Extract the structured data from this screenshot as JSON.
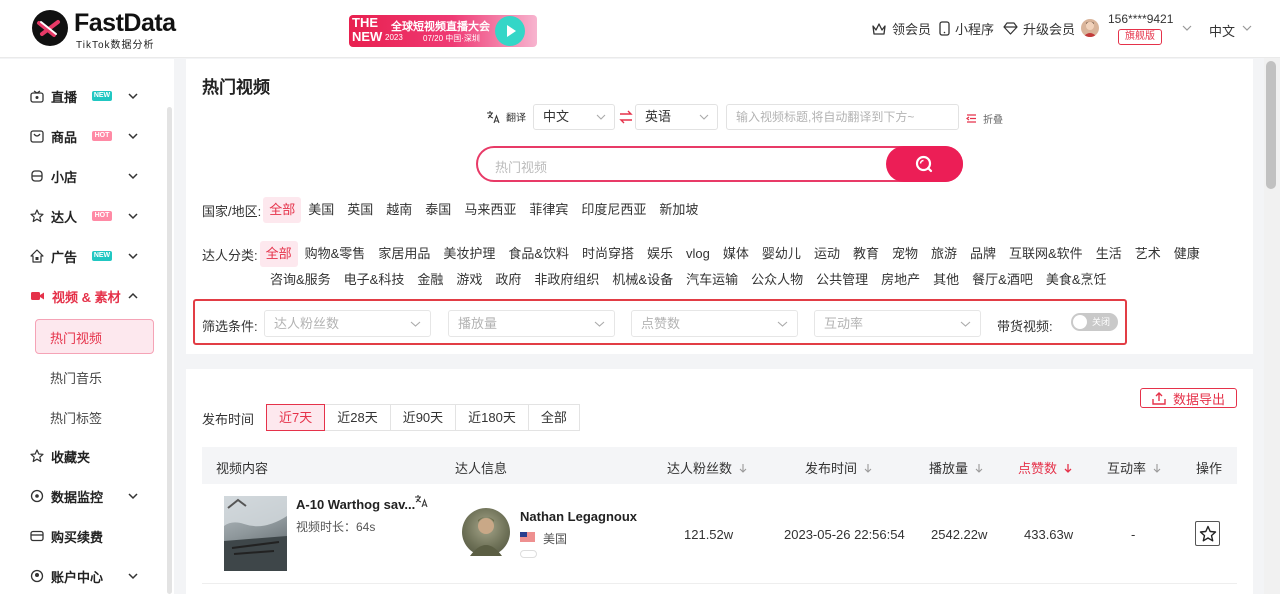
{
  "header": {
    "logo_name": "FastData",
    "logo_sub": "TikTok数据分析",
    "banner": {
      "the": "THE",
      "new": "NEW",
      "title": "全球短视频直播大会",
      "year": "2023",
      "date": "07/20 中国·深圳"
    },
    "nav": [
      {
        "label": "领会员",
        "icon": "crown-icon"
      },
      {
        "label": "小程序",
        "icon": "phone-icon"
      },
      {
        "label": "升级会员",
        "icon": "diamond-icon"
      }
    ],
    "user_phone": "156****9421",
    "user_plan": "旗舰版",
    "language": "中文"
  },
  "sidebar": {
    "items": [
      {
        "label": "直播",
        "icon": "live-icon",
        "badge": "NEW"
      },
      {
        "label": "商品",
        "icon": "bag-icon",
        "badge": "HOT"
      },
      {
        "label": "小店",
        "icon": "store-icon",
        "badge": ""
      },
      {
        "label": "达人",
        "icon": "star-icon",
        "badge": "HOT"
      },
      {
        "label": "广告",
        "icon": "ad-icon",
        "badge": "NEW"
      },
      {
        "label": "视频 & 素材",
        "icon": "video-icon",
        "badge": "",
        "active": true
      },
      {
        "label": "收藏夹",
        "icon": "star-outline-icon",
        "badge": ""
      },
      {
        "label": "数据监控",
        "icon": "monitor-icon",
        "badge": ""
      },
      {
        "label": "购买续费",
        "icon": "card-icon",
        "badge": ""
      },
      {
        "label": "账户中心",
        "icon": "user-icon",
        "badge": ""
      }
    ],
    "sub_items": [
      "热门视频",
      "热门音乐",
      "热门标签"
    ]
  },
  "page": {
    "title": "热门视频",
    "translate_label": "翻译",
    "source_lang": "中文",
    "target_lang": "英语",
    "translate_placeholder": "输入视频标题,将自动翻译到下方~",
    "fold_label": "折叠",
    "search_placeholder": "热门视频"
  },
  "filters": {
    "region_label": "国家/地区:",
    "regions": [
      "全部",
      "美国",
      "英国",
      "越南",
      "泰国",
      "马来西亚",
      "菲律宾",
      "印度尼西亚",
      "新加坡"
    ],
    "category_label": "达人分类:",
    "categories_row1": [
      "全部",
      "购物&零售",
      "家居用品",
      "美妆护理",
      "食品&饮料",
      "时尚穿搭",
      "娱乐",
      "vlog",
      "媒体",
      "婴幼儿",
      "运动",
      "教育",
      "宠物",
      "旅游",
      "品牌",
      "互联网&软件",
      "生活",
      "艺术",
      "健康"
    ],
    "categories_row2": [
      "咨询&服务",
      "电子&科技",
      "金融",
      "游戏",
      "政府",
      "非政府组织",
      "机械&设备",
      "汽车运输",
      "公众人物",
      "公共管理",
      "房地产",
      "其他",
      "餐厅&酒吧",
      "美食&烹饪"
    ],
    "condition_label": "筛选条件:",
    "conditions": [
      "达人粉丝数",
      "播放量",
      "点赞数",
      "互动率"
    ],
    "goods_label": "带货视频:",
    "goods_toggle": "关闭"
  },
  "results": {
    "time_label": "发布时间",
    "time_tabs": [
      "近7天",
      "近28天",
      "近90天",
      "近180天",
      "全部"
    ],
    "export_label": "数据导出",
    "columns": [
      "视频内容",
      "达人信息",
      "达人粉丝数",
      "发布时间",
      "播放量",
      "点赞数",
      "互动率",
      "操作"
    ],
    "rows": [
      {
        "video_title": "A-10 Warthog sav...",
        "duration": "视频时长：64s",
        "creator": "Nathan Legagnoux",
        "country": "美国",
        "followers": "121.52w",
        "published": "2023-05-26 22:56:54",
        "views": "2542.22w",
        "likes": "433.63w",
        "engagement": "-"
      }
    ]
  },
  "colors": {
    "accent": "#e5324a",
    "search": "#ec1e56",
    "new_badge": "#21c7c2",
    "hot_badge": "#ff8aa5"
  }
}
